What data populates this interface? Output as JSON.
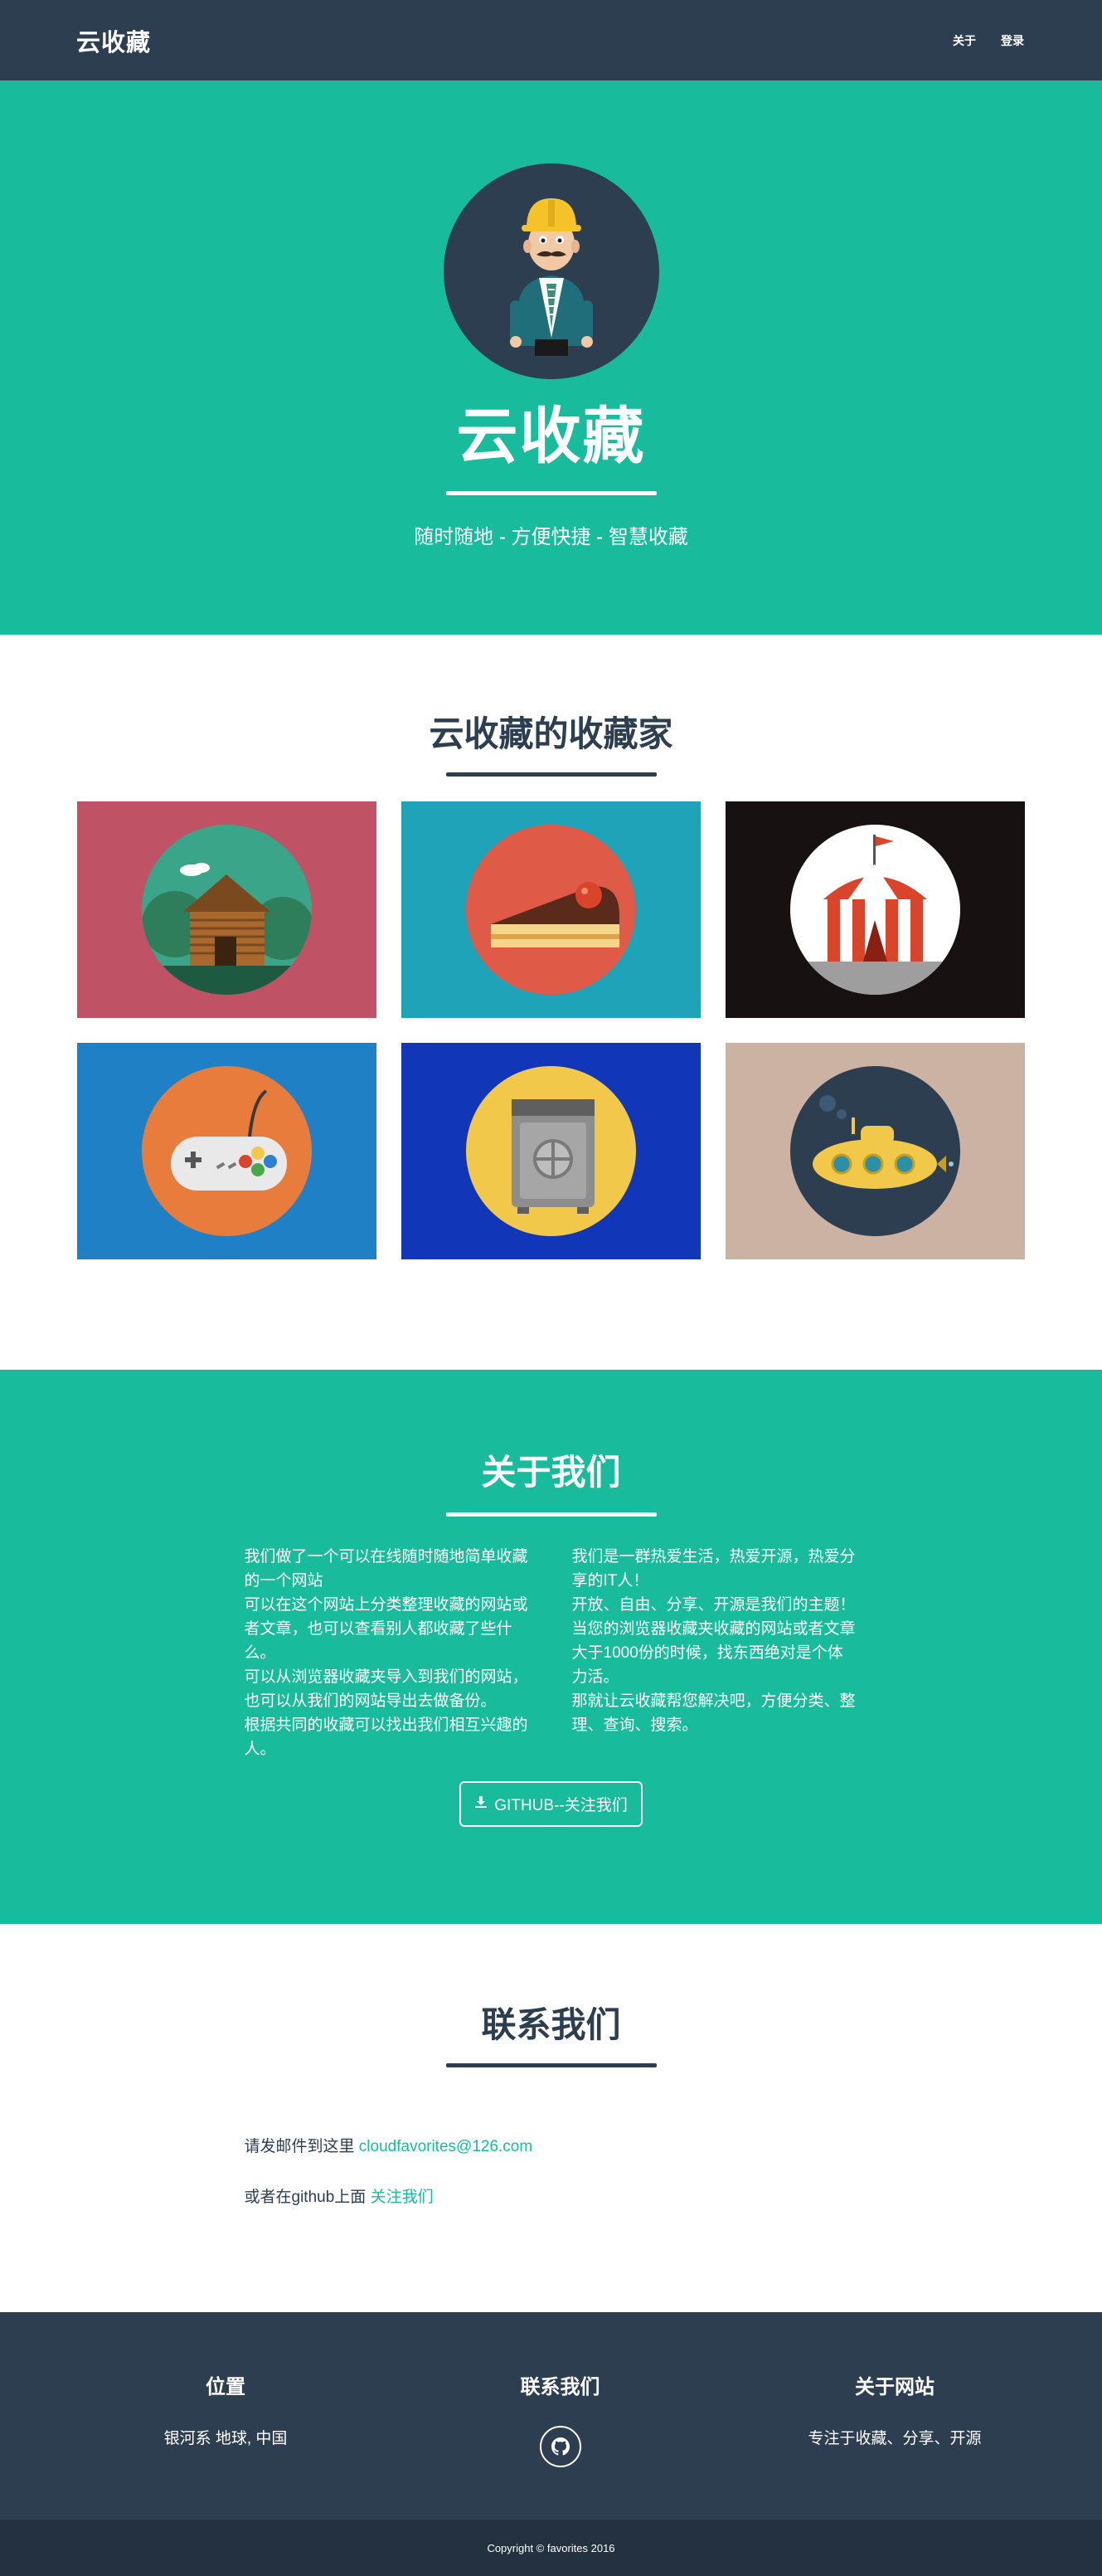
{
  "navbar": {
    "brand": "云收藏",
    "links": [
      "关于",
      "登录"
    ]
  },
  "hero": {
    "title": "云收藏",
    "subtitle": "随时随地 - 方便快捷 - 智慧收藏"
  },
  "portfolio": {
    "title": "云收藏的收藏家",
    "tiles": [
      {
        "icon": "cabin-icon",
        "bg": "#bf5264",
        "circle": "#3aa589"
      },
      {
        "icon": "cake-icon",
        "bg": "#1fa3b8",
        "circle": "#e05a48"
      },
      {
        "icon": "circus-tent-icon",
        "bg": "#171112",
        "circle": "#ffffff"
      },
      {
        "icon": "game-controller-icon",
        "bg": "#1f80c6",
        "circle": "#e87c3d"
      },
      {
        "icon": "safe-icon",
        "bg": "#1136b8",
        "circle": "#f2c84a"
      },
      {
        "icon": "submarine-icon",
        "bg": "#ccb2a3",
        "circle": "#2c3e50"
      }
    ]
  },
  "about": {
    "title": "关于我们",
    "left": [
      "我们做了一个可以在线随时随地简单收藏的一个网站",
      "可以在这个网站上分类整理收藏的网站或者文章，也可以查看别人都收藏了些什么。",
      "可以从浏览器收藏夹导入到我们的网站，也可以从我们的网站导出去做备份。",
      "根据共同的收藏可以找出我们相互兴趣的人。"
    ],
    "right": [
      "我们是一群热爱生活，热爱开源，热爱分享的IT人！",
      "开放、自由、分享、开源是我们的主题！",
      "当您的浏览器收藏夹收藏的网站或者文章大于1000份的时候，找东西绝对是个体力活。",
      "那就让云收藏帮您解决吧，方便分类、整理、查询、搜索。"
    ],
    "button": "GITHUB--关注我们"
  },
  "contact": {
    "title": "联系我们",
    "email_prefix": "请发邮件到这里",
    "email": "cloudfavorites@126.com",
    "github_prefix": "或者在github上面",
    "github_link": "关注我们"
  },
  "footer": {
    "location_title": "位置",
    "location_text": "银河系 地球, 中国",
    "contact_title": "联系我们",
    "about_title": "关于网站",
    "about_text": "专注于收藏、分享、开源",
    "copyright": "Copyright © favorites 2016"
  },
  "colors": {
    "primary": "#2c3e50",
    "accent": "#18bc9c"
  }
}
